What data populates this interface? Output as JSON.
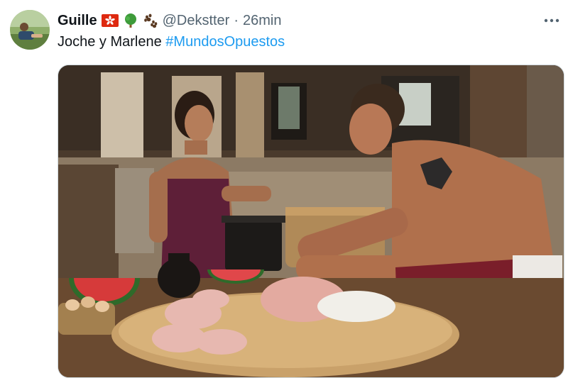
{
  "tweet": {
    "display_name": "Guille",
    "name_emojis": [
      "hong-kong-flag-icon",
      "deciduous-tree-icon",
      "paw-prints-icon"
    ],
    "handle": "@Dekstter",
    "separator": "·",
    "timestamp": "26min",
    "text_prefix": "Joche y Marlene ",
    "hashtag": "#MundosOpuestos",
    "more_icon": "more-options-icon",
    "colors": {
      "hashtag": "#1d9bf0",
      "secondary_text": "#536471",
      "border": "#cfd9de"
    }
  }
}
